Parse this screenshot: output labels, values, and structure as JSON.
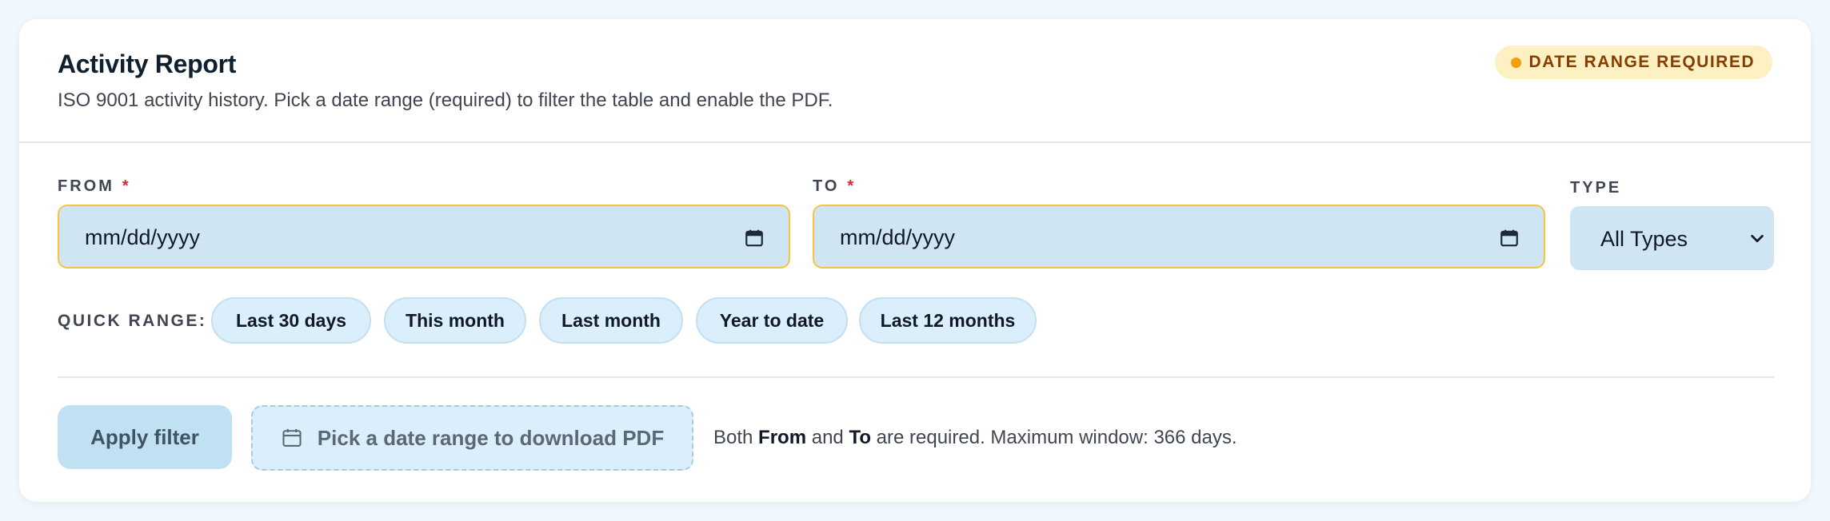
{
  "header": {
    "title": "Activity Report",
    "subtitle": "ISO 9001 activity history. Pick a date range (required) to filter the table and enable the PDF.",
    "badge": "DATE RANGE REQUIRED"
  },
  "filters": {
    "from": {
      "label": "FROM",
      "required_mark": "*",
      "placeholder": "mm/dd/yyyy",
      "icon": "calendar-icon"
    },
    "to": {
      "label": "TO",
      "required_mark": "*",
      "placeholder": "mm/dd/yyyy",
      "icon": "calendar-icon"
    },
    "type": {
      "label": "TYPE",
      "selected": "All Types",
      "icon": "chevron-down-icon"
    }
  },
  "quick_range": {
    "label": "QUICK RANGE:",
    "options": [
      "Last 30 days",
      "This month",
      "Last month",
      "Year to date",
      "Last 12 months"
    ]
  },
  "actions": {
    "apply_label": "Apply filter",
    "pdf_label": "Pick a date range to download PDF",
    "pdf_icon": "calendar-icon",
    "hint": {
      "prefix": "Both ",
      "from": "From",
      "middle": " and ",
      "to": "To",
      "suffix": " are required. Maximum window: 366 days."
    }
  },
  "colors": {
    "page_bg": "#f0f7fd",
    "input_bg": "#cfe5f3",
    "input_border_warning": "#f5c542",
    "badge_bg": "#fdf0c2",
    "badge_text": "#8a3c00",
    "badge_dot": "#f59e0b",
    "required": "#dc2626",
    "chip_bg": "#dbeefb",
    "apply_bg": "#bfe1f2"
  }
}
